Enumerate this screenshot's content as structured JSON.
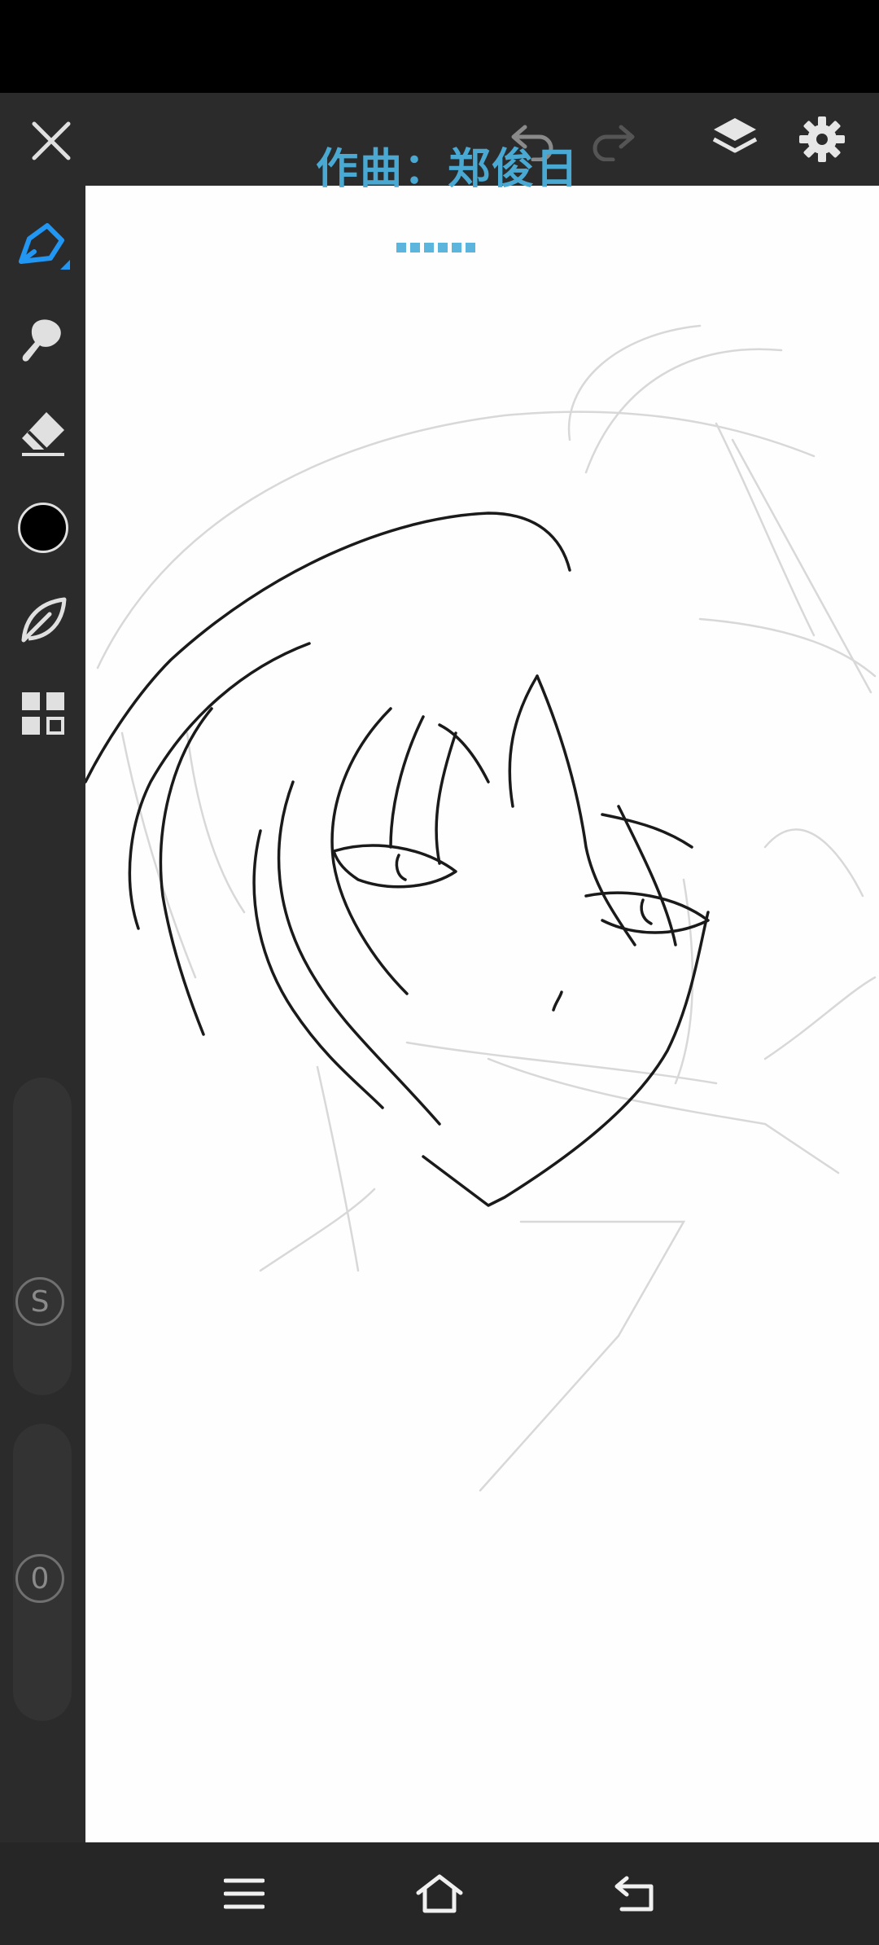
{
  "overlay": {
    "lyric_text": "作曲：郑俊日"
  },
  "toolbar": {
    "close": "close-icon",
    "undo": "undo-icon",
    "redo": "redo-icon",
    "layers": "layers-icon",
    "settings": "gear-icon"
  },
  "tools": {
    "brush": "pen-icon",
    "smudge": "smudge-icon",
    "eraser": "eraser-icon",
    "color": "#000000",
    "blend": "leaf-icon",
    "more": "grid-icon"
  },
  "sliders": {
    "size_label": "S",
    "opacity_label": "0"
  },
  "colors": {
    "accent": "#2196f3",
    "toolbar_bg": "#2b2b2b",
    "canvas_bg": "#fefefe",
    "overlay_text": "#49a9d3"
  },
  "nav": {
    "menu": "menu-icon",
    "home": "home-icon",
    "back": "back-icon"
  }
}
